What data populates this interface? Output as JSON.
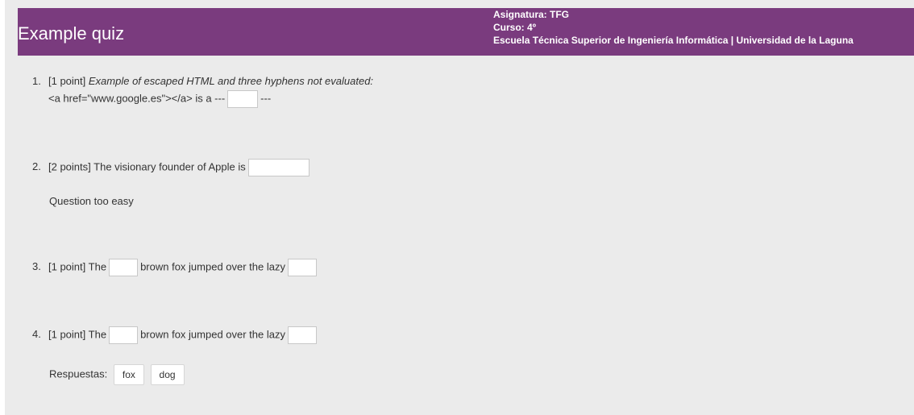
{
  "header": {
    "title": "Example quiz",
    "subject": "Asignatura: TFG",
    "course": "Curso: 4º",
    "school": "Escuela Técnica Superior de Ingeniería Informática | Universidad de la Laguna"
  },
  "questions": [
    {
      "number": "1.",
      "points": "[1 point]",
      "text_italic": "Example of escaped HTML and three hyphens not evaluated:",
      "line2_before": "<a href=\"www.google.es\"></a> is a ---",
      "line2_after": "---",
      "blank_value": ""
    },
    {
      "number": "2.",
      "points": "[2 points]",
      "text_before": "The visionary founder of Apple is",
      "blank_value": "",
      "feedback": "Question too easy"
    },
    {
      "number": "3.",
      "points": "[1 point]",
      "text_before": "The",
      "text_middle": "brown fox jumped over the lazy",
      "blank1_value": "",
      "blank2_value": ""
    },
    {
      "number": "4.",
      "points": "[1 point]",
      "text_before": "The",
      "text_middle": "brown fox jumped over the lazy",
      "blank1_value": "",
      "blank2_value": "",
      "answers_label": "Respuestas:",
      "answers": [
        "fox",
        "dog"
      ]
    }
  ]
}
